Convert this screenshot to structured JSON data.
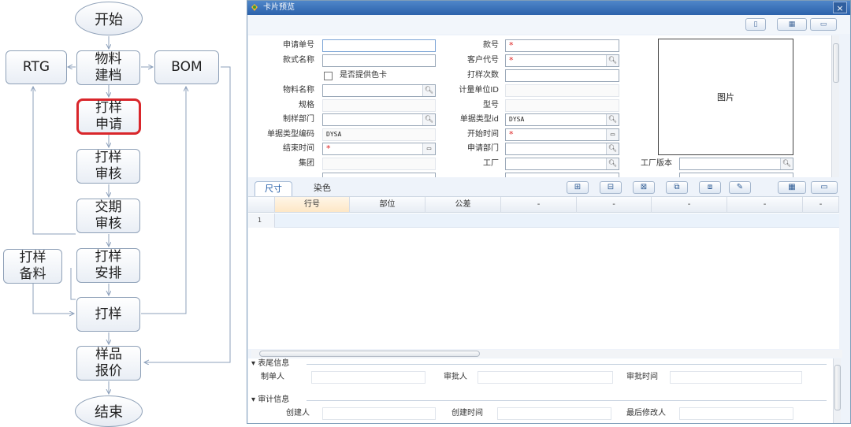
{
  "flow": {
    "start": "开始",
    "end": "结束",
    "rtg": "RTG",
    "bom": "BOM",
    "material_doc": "物料\n建档",
    "sample_request": "打样\n申请",
    "sample_review": "打样\n审核",
    "delivery_review": "交期\n审核",
    "sample_prep": "打样\n备料",
    "sample_schedule": "打样\n安排",
    "sampling": "打样",
    "sample_quote": "样品\n报价"
  },
  "window": {
    "title": "卡片预览",
    "close": "×"
  },
  "form": {
    "apply_no_label": "申请单号",
    "style_name_label": "款式名称",
    "provide_color_card": "是否提供色卡",
    "material_name_label": "物料名称",
    "spec_label": "规格",
    "make_dept_label": "制样部门",
    "doc_type_code_label": "单据类型编码",
    "doc_type_code_value": "DYSA",
    "end_time_label": "结束时间",
    "group_label": "集团",
    "style_no_label": "款号",
    "customer_code_label": "客户代号",
    "sample_count_label": "打样次数",
    "unit_id_label": "计量单位ID",
    "model_label": "型号",
    "doc_type_label": "单据类型id",
    "doc_type_value": "DYSA",
    "start_time_label": "开始时间",
    "apply_dept_label": "申请部门",
    "factory_label": "工厂",
    "factory_version_label": "工厂版本",
    "required_mark": "*",
    "picture_label": "图片"
  },
  "tabs": [
    "尺寸",
    "染色"
  ],
  "grid": {
    "columns": [
      "行号",
      "部位",
      "公差",
      "-",
      "-",
      "-",
      "-",
      "-"
    ],
    "rows": [
      [
        "1"
      ]
    ]
  },
  "footer": {
    "section1_title": "表尾信息",
    "maker_label": "制单人",
    "approver_label": "审批人",
    "approve_time_label": "审批时间",
    "section2_title": "审计信息",
    "creator_label": "创建人",
    "create_time_label": "创建时间",
    "last_modifier_label": "最后修改人"
  },
  "icons": {
    "search": "search-icon",
    "calendar": "calendar-icon",
    "add_row": "add-row-icon",
    "insert_row": "insert-row-icon",
    "delete_row": "delete-row-icon",
    "copy_row": "copy-row-icon",
    "paste_row": "paste-row-icon",
    "edit": "edit-icon",
    "layout": "layout-icon",
    "maximize": "maximize-icon"
  },
  "colors": {
    "highlight": "#d9262b",
    "titlebar": "#2c62ab"
  }
}
